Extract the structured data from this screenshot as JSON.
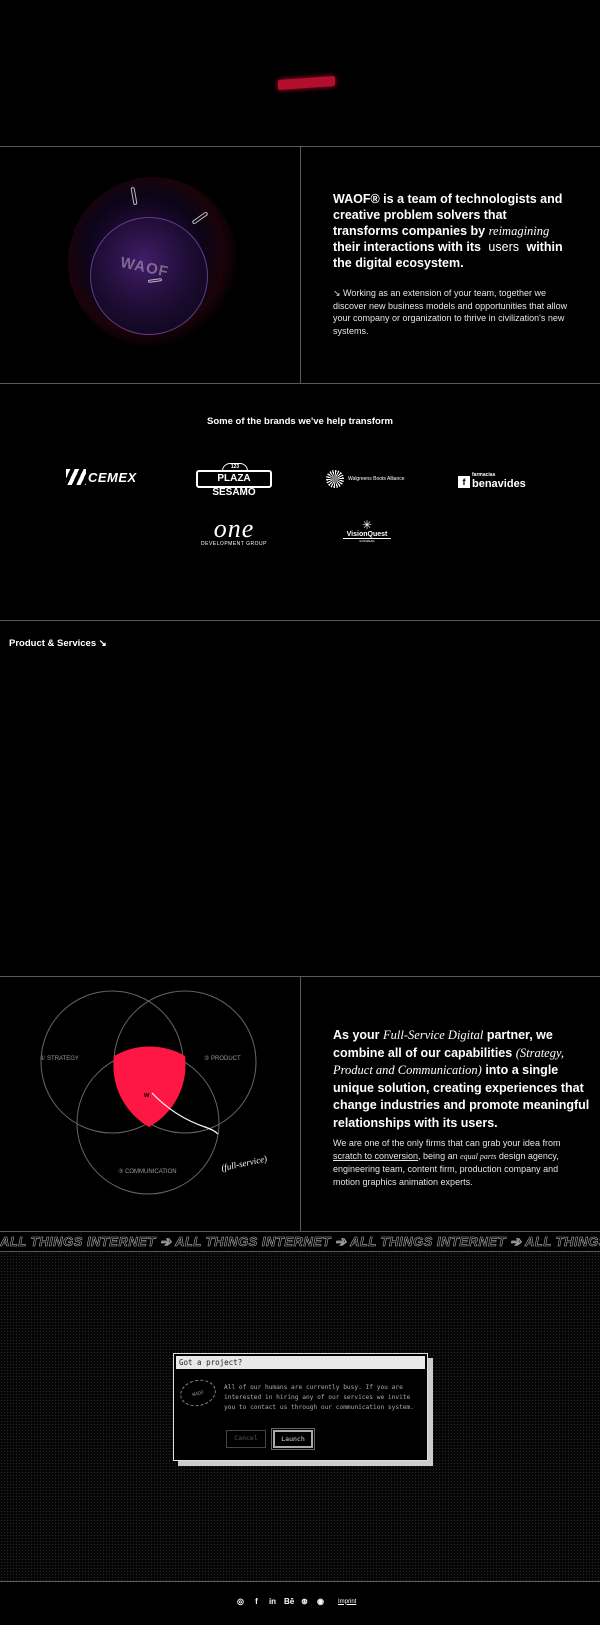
{
  "about": {
    "headline_1": "WAOF® is a team of technologists and creative problem solvers that transforms companies by",
    "headline_italic": "reimagining",
    "headline_2": "their interactions with its",
    "headline_rot": "users",
    "headline_3": "within the digital ecosystem.",
    "body": "↘ Working as an extension of your team, together we discover new business models and opportunities that allow your company or organization to thrive in civilization's new systems.",
    "orb_text": "WAOF"
  },
  "brands": {
    "title": "Some of the brands we've help transform",
    "logos": {
      "cemex": "CEMEX",
      "plaza": "PLAZA SESAMO",
      "plaza_cap": "123",
      "walgreens": "Walgreens Boots Alliance",
      "benavides_small": "farmacias",
      "benavides": "benavides",
      "one_script": "one",
      "one_sub": "DEVELOPMENT GROUP",
      "vq_name": "VisionQuest",
      "vq_sub": "EYEWEAR"
    }
  },
  "services": {
    "title": "Product & Services ↘"
  },
  "venn": {
    "labels": {
      "strategy": "① STRATEGY",
      "product": "② PRODUCT",
      "communication": "③ COMMUNICATION",
      "center": "w",
      "callout": "(full-service)"
    },
    "headline_1": "As your",
    "headline_italic_1": "Full-Service Digital",
    "headline_2": "partner, we combine all of our capabilities",
    "headline_italic_2": "(Strategy, Product and Communication)",
    "headline_3": "into a single unique solution, creating experiences that change industries and promote meaningful relationships with its users.",
    "body_1": "We are one of the only firms that can grab your idea from",
    "body_link": "scratch to conversion",
    "body_2": ", being an",
    "body_italic": "equal parts",
    "body_3": "design agency, engineering team, content firm, production company and motion graphics animation experts.",
    "accent": "#ff1744"
  },
  "marquee": {
    "text": "ALL THINGS INTERNET ➔ ALL THINGS INTERNET ➔ ALL THINGS INTERNET ➔ ALL THINGS INTERNET ➔"
  },
  "dialog": {
    "title": "Got a project?",
    "icon_text": "WAOF",
    "message": "All of our humans are currently busy. If you are interested in hiring any of our services we invite you to contact us through our communication system.",
    "cancel": "Cancel",
    "launch": "Launch"
  },
  "footer": {
    "icons": [
      "instagram-icon",
      "facebook-icon",
      "linkedin-icon",
      "behance-icon",
      "dribbble-icon",
      "github-icon"
    ],
    "icon_glyphs": {
      "instagram": "◎",
      "facebook": "f",
      "linkedin": "in",
      "behance": "Bē",
      "dribbble": "⊛",
      "github": "◉"
    },
    "imprint": "Imprint"
  }
}
